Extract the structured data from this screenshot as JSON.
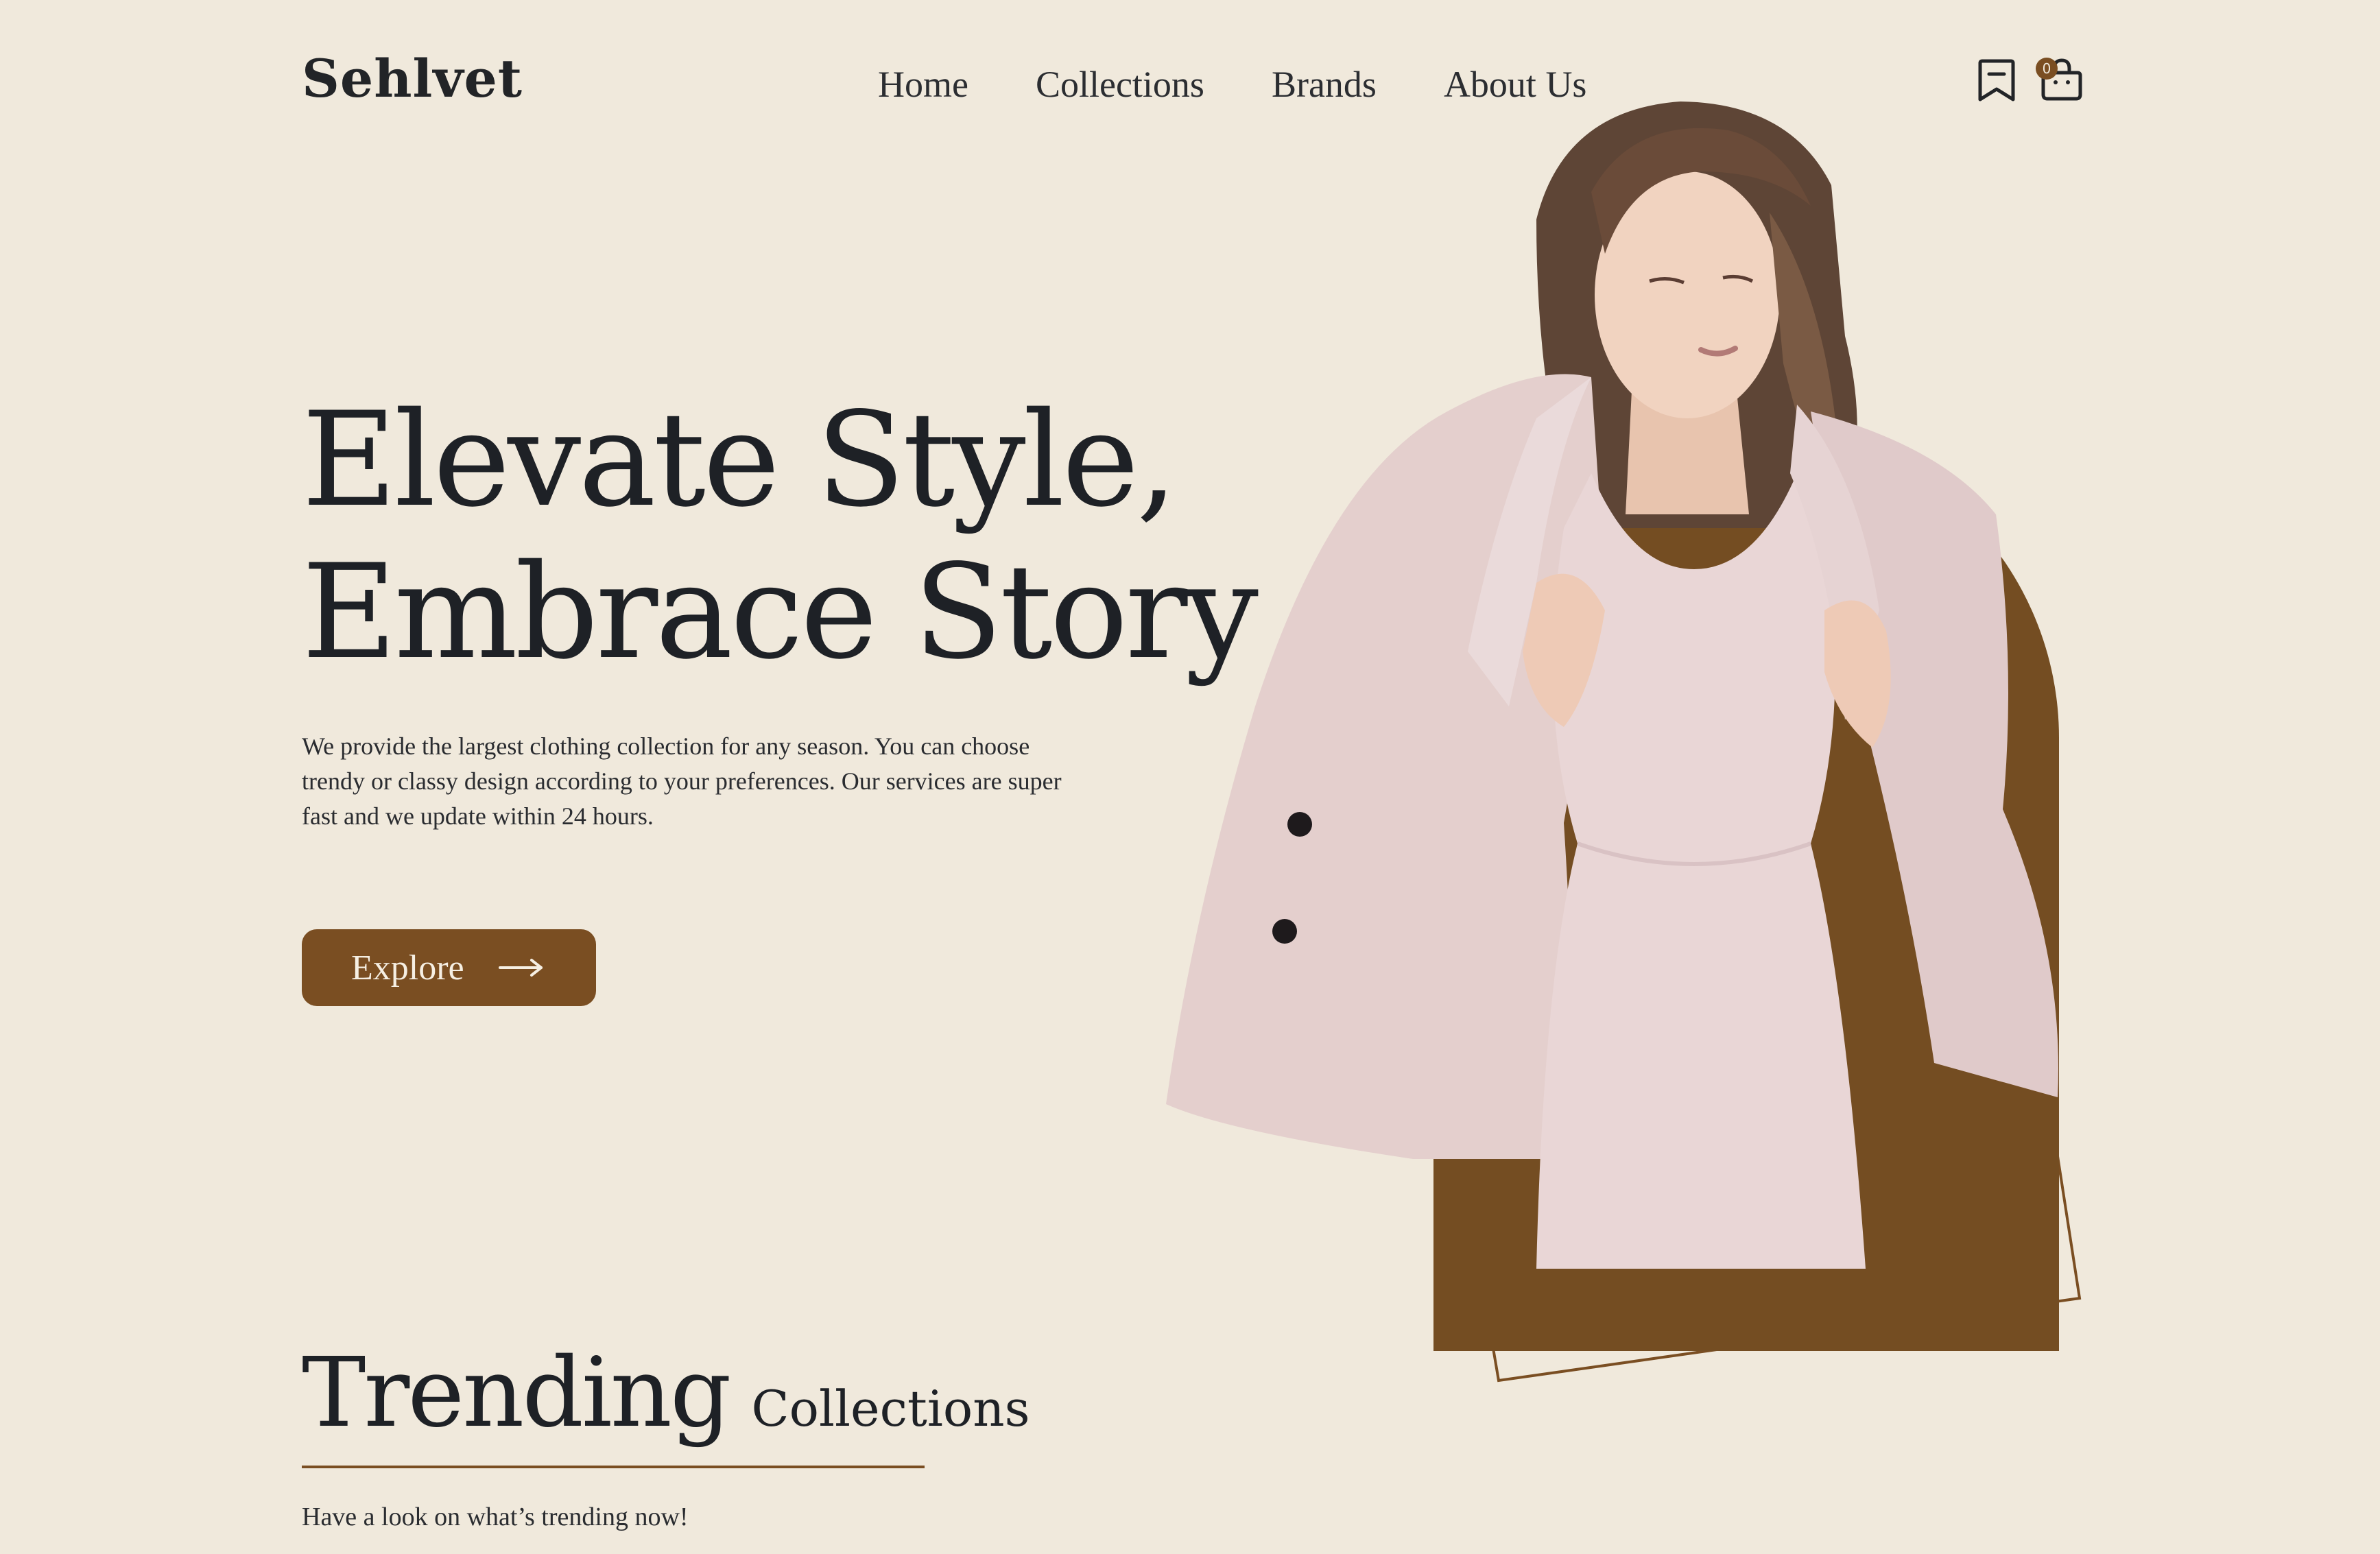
{
  "brand": {
    "name": "Sehlvet"
  },
  "nav": {
    "items": [
      {
        "label": "Home"
      },
      {
        "label": "Collections"
      },
      {
        "label": "Brands"
      },
      {
        "label": "About Us"
      }
    ]
  },
  "header_icons": {
    "bookmark": "bookmark-icon",
    "bag": "shopping-bag-icon",
    "bag_count": "0"
  },
  "hero": {
    "title_line1": "Elevate Style,",
    "title_line2": "Embrace Story",
    "description": "We provide the largest clothing collection for any season. You can choose trendy or classy design according to your preferences. Our services are super fast and we update within 24 hours.",
    "cta_label": "Explore",
    "cta_icon": "arrow-right-icon"
  },
  "trending": {
    "title_main": "Trending",
    "title_secondary": "Collections",
    "subtitle": "Have a look on what’s trending now!"
  },
  "colors": {
    "background": "#F0E9DC",
    "accent_brown": "#7A4E22",
    "text_dark": "#1E2126"
  }
}
